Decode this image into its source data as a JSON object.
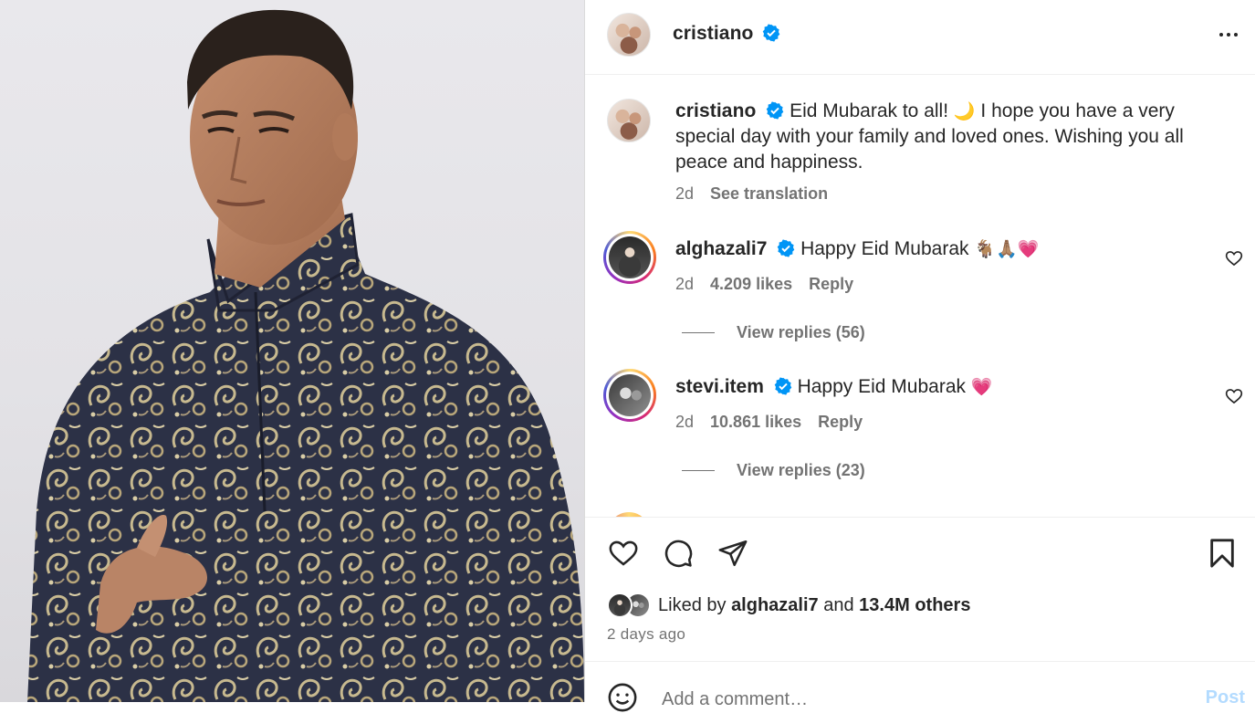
{
  "colors": {
    "verified_blue": "#0095f6",
    "text_primary": "#262626",
    "text_secondary": "#737373",
    "post_disabled": "#b3dbff",
    "heart_red": "#e8265e"
  },
  "header": {
    "username": "cristiano",
    "verified_icon": "verified-badge-icon",
    "more_icon": "more-options-icon"
  },
  "caption": {
    "username": "cristiano",
    "text": "Eid Mubarak to all!",
    "emoji": "🌙",
    "text_rest": "I hope you have a very special day with your family and loved ones. Wishing you all peace and happiness.",
    "time": "2d",
    "see_translation": "See translation"
  },
  "comments": [
    {
      "username": "alghazali7",
      "text": "Happy Eid Mubarak",
      "emojis": "🐐🙏🏽💗",
      "time": "2d",
      "likes": "4.209 likes",
      "reply": "Reply",
      "view_replies": "View replies (56)"
    },
    {
      "username": "stevi.item",
      "text": "Happy Eid Mubarak",
      "emojis": "💗",
      "time": "2d",
      "likes": "10.861 likes",
      "reply": "Reply",
      "view_replies": "View replies (23)"
    }
  ],
  "actions": {
    "like_icon": "heart-icon",
    "comment_icon": "comment-bubble-icon",
    "share_icon": "paper-plane-icon",
    "save_icon": "bookmark-icon"
  },
  "likes": {
    "prefix": "Liked by",
    "user": "alghazali7",
    "joiner": "and",
    "others": "13.4M others"
  },
  "time_ago": "2 days ago",
  "add_comment": {
    "placeholder": "Add a comment…",
    "post_label": "Post",
    "emoji_icon": "smiley-face-icon"
  }
}
